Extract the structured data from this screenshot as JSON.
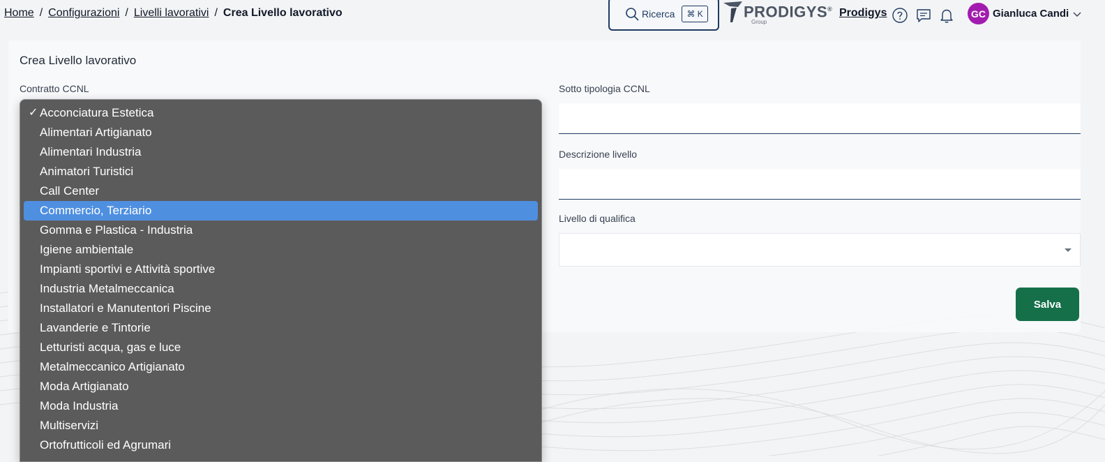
{
  "breadcrumb": {
    "home": "Home",
    "config": "Configurazioni",
    "levels": "Livelli lavorativi",
    "current": "Crea Livello lavorativo",
    "separator": "/"
  },
  "search": {
    "label": "Ricerca",
    "shortcut": "⌘ K"
  },
  "brand": {
    "name": "PRODIGYS",
    "registered": "®",
    "sub": "Group",
    "org_link": "Prodigys"
  },
  "user": {
    "initials": "GC",
    "name": "Gianluca Candi",
    "avatar_color": "#a21caf"
  },
  "form": {
    "title": "Crea Livello lavorativo",
    "ccnl_label": "Contratto CCNL",
    "subtype_label": "Sotto tipologia CCNL",
    "subtype_value": "",
    "description_label": "Descrizione livello",
    "description_value": "",
    "qualification_label": "Livello di qualifica",
    "qualification_value": "",
    "save_label": "Salva"
  },
  "dropdown": {
    "checked_item": "Acconciatura Estetica",
    "highlighted_item": "Commercio, Terziario",
    "items": [
      "Acconciatura Estetica",
      "Alimentari Artigianato",
      "Alimentari Industria",
      "Animatori Turistici",
      "Call Center",
      "Commercio, Terziario",
      "Gomma e Plastica - Industria",
      "Igiene ambientale",
      "Impianti sportivi e Attività sportive",
      "Industria Metalmeccanica",
      "Installatori e Manutentori Piscine",
      "Lavanderie e Tintorie",
      "Letturisti acqua, gas e luce",
      "Metalmeccanico Artigianato",
      "Moda Artigianato",
      "Moda Industria",
      "Multiservizi",
      "Ortofrutticoli ed Agrumari"
    ]
  },
  "colors": {
    "primary": "#15704a",
    "highlight": "#4f8fe0",
    "dropdown_bg": "#5b5b5b",
    "navy": "#1e3a5f"
  }
}
